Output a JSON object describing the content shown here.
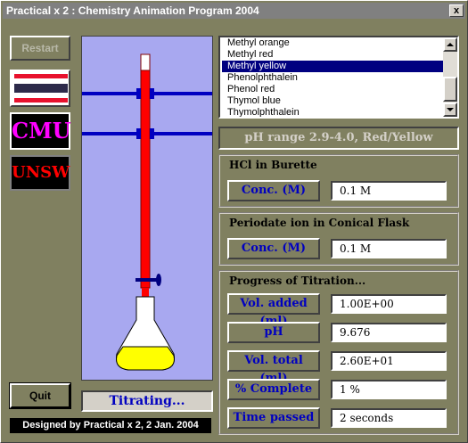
{
  "window": {
    "title": "Practical x 2 : Chemistry Animation Program 2004",
    "close_glyph": "x"
  },
  "left": {
    "restart_label": "Restart",
    "logos": {
      "cmu": "CMU",
      "unsw": "UNSW"
    },
    "quit_label": "Quit",
    "status": "Titrating...",
    "footer": "Designed by Practical x 2, 2 Jan. 2004"
  },
  "apparatus": {
    "flask_fill_color": "#ffff00",
    "burette_color": "#ff0000",
    "drop_color": "#ff0000"
  },
  "indicators": {
    "items": [
      "Methyl orange",
      "Methyl red",
      "Methyl yellow",
      "Phenolphthalein",
      "Phenol red",
      "Thymol blue",
      "Thymolphthalein"
    ],
    "selected": "Methyl yellow",
    "range_text": "pH range 2.9-4.0, Red/Yellow"
  },
  "burette_group": {
    "title": "HCl in Burette",
    "conc_label": "Conc. (M)",
    "conc_value": "0.1 M"
  },
  "flask_group": {
    "title": "Periodate ion in Conical Flask",
    "conc_label": "Conc. (M)",
    "conc_value": "0.1 M"
  },
  "progress": {
    "title": "Progress of Titration...",
    "vol_added_label": "Vol. added (ml)",
    "vol_added_value": "1.00E+00",
    "ph_label": "pH",
    "ph_value": "9.676",
    "vol_total_label": "Vol. total (ml)",
    "vol_total_value": "2.60E+01",
    "complete_label": "% Complete",
    "complete_value": "1 %",
    "time_label": "Time passed",
    "time_value": "2 seconds"
  }
}
